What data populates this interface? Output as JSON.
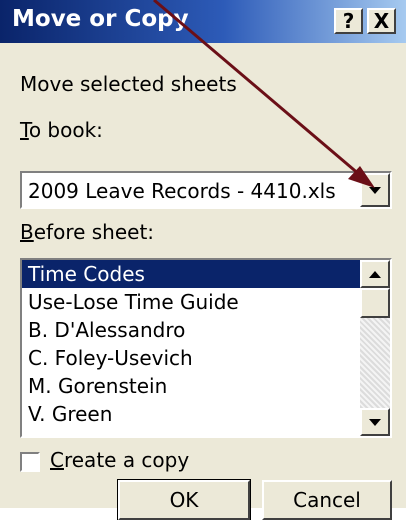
{
  "window": {
    "title": "Move or Copy",
    "help_label": "?",
    "close_label": "X"
  },
  "dialog": {
    "move_label": "Move selected sheets",
    "to_book": {
      "label_hotkey": "T",
      "label_rest": "o book:",
      "value": "2009 Leave Records - 4410.xls"
    },
    "before_sheet": {
      "label_hotkey": "B",
      "label_rest": "efore sheet:",
      "items": [
        "Time Codes",
        "Use-Lose Time Guide",
        "B. D'Alessandro",
        "C. Foley-Usevich",
        "M. Gorenstein",
        "V. Green"
      ],
      "selected": "Time Codes"
    },
    "create_copy": {
      "label_hotkey": "C",
      "label_rest": "reate a copy",
      "checked": false
    },
    "ok_label": "OK",
    "cancel_label": "Cancel"
  },
  "colors": {
    "title_bar": "#0a246a",
    "selection": "#0a246a",
    "annotation_arrow": "#6b0f17"
  }
}
